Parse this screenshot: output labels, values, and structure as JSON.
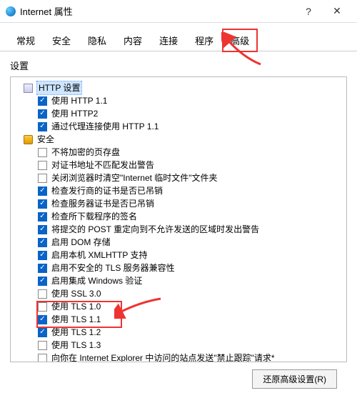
{
  "window": {
    "title": "Internet 属性",
    "help": "?",
    "close": "✕"
  },
  "tabs": {
    "items": [
      {
        "label": "常规"
      },
      {
        "label": "安全"
      },
      {
        "label": "隐私"
      },
      {
        "label": "内容"
      },
      {
        "label": "连接"
      },
      {
        "label": "程序"
      },
      {
        "label": "高级",
        "active": true,
        "highlight": true
      }
    ]
  },
  "settings_label": "设置",
  "tree": [
    {
      "type": "header",
      "icon": "doc",
      "label": "HTTP 设置",
      "selected": true
    },
    {
      "type": "check",
      "checked": true,
      "label": "使用 HTTP 1.1"
    },
    {
      "type": "check",
      "checked": true,
      "label": "使用 HTTP2"
    },
    {
      "type": "check",
      "checked": true,
      "label": "通过代理连接使用 HTTP 1.1"
    },
    {
      "type": "header",
      "icon": "lock",
      "label": "安全"
    },
    {
      "type": "check",
      "checked": false,
      "label": "不将加密的页存盘"
    },
    {
      "type": "check",
      "checked": false,
      "label": "对证书地址不匹配发出警告"
    },
    {
      "type": "check",
      "checked": false,
      "label": "关闭浏览器时清空\"Internet 临时文件\"文件夹"
    },
    {
      "type": "check",
      "checked": true,
      "label": "检查发行商的证书是否已吊销"
    },
    {
      "type": "check",
      "checked": true,
      "label": "检查服务器证书是否已吊销"
    },
    {
      "type": "check",
      "checked": true,
      "label": "检查所下载程序的签名"
    },
    {
      "type": "check",
      "checked": true,
      "label": "将提交的 POST 重定向到不允许发送的区域时发出警告"
    },
    {
      "type": "check",
      "checked": true,
      "label": "启用 DOM 存储"
    },
    {
      "type": "check",
      "checked": true,
      "label": "启用本机 XMLHTTP 支持"
    },
    {
      "type": "check",
      "checked": true,
      "label": "启用不安全的 TLS 服务器兼容性"
    },
    {
      "type": "check",
      "checked": true,
      "label": "启用集成 Windows 验证"
    },
    {
      "type": "check",
      "checked": false,
      "label": "使用 SSL 3.0"
    },
    {
      "type": "check",
      "checked": false,
      "label": "使用 TLS 1.0"
    },
    {
      "type": "check",
      "checked": true,
      "label": "使用 TLS 1.1",
      "emph": true
    },
    {
      "type": "check",
      "checked": true,
      "label": "使用 TLS 1.2",
      "emph": true
    },
    {
      "type": "check",
      "checked": false,
      "label": "使用 TLS 1.3"
    },
    {
      "type": "check",
      "checked": false,
      "label": "向你在 Internet Explorer 中访问的站点发送\"禁止跟踪\"请求*"
    }
  ],
  "restore_button": "还原高级设置(R)"
}
